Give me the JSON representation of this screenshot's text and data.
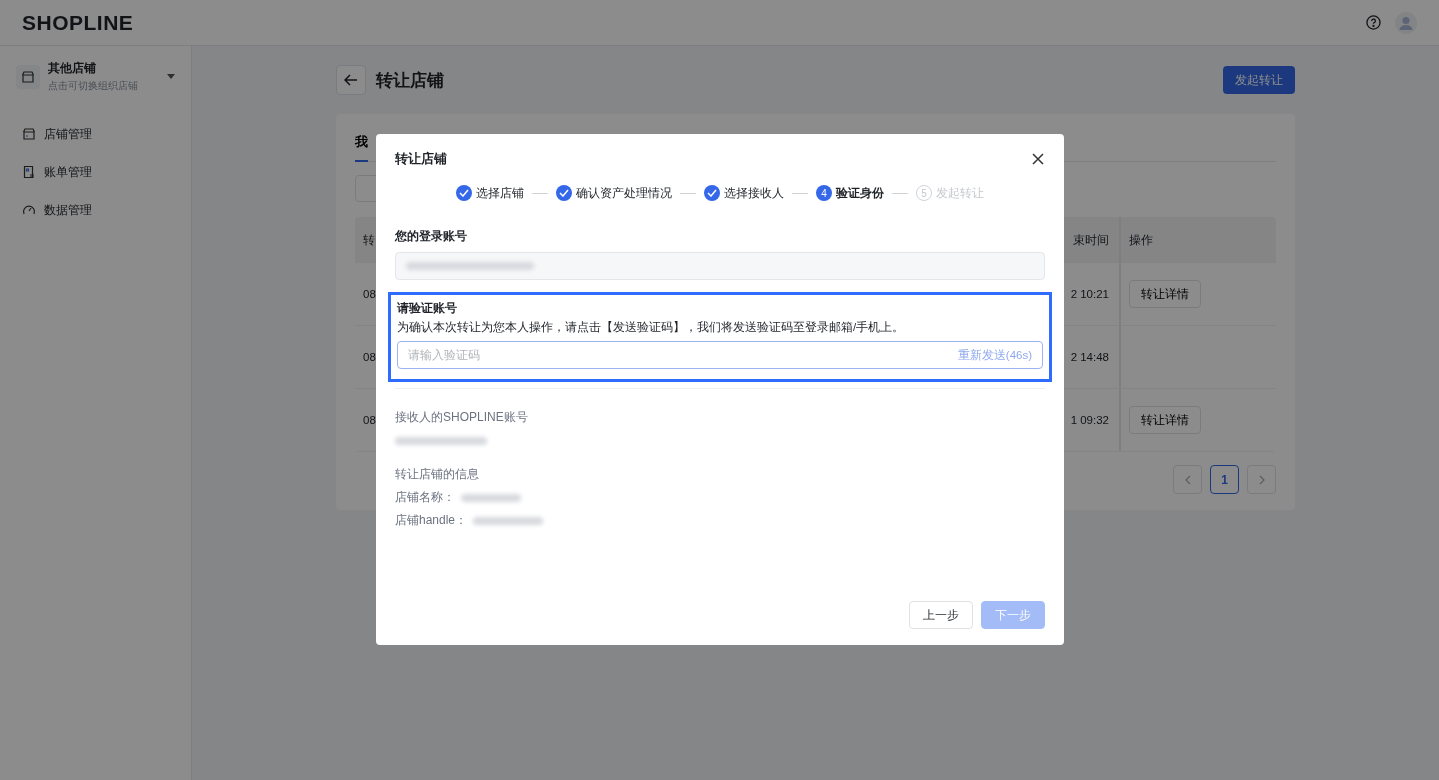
{
  "topbar": {
    "logo": "SHOPLINE"
  },
  "sidebar": {
    "store": {
      "name": "其他店铺",
      "hint": "点击可切换组织店铺"
    },
    "items": [
      {
        "label": "店铺管理",
        "selected": false
      },
      {
        "label": "账单管理",
        "selected": false
      },
      {
        "label": "数据管理",
        "selected": false
      }
    ]
  },
  "page": {
    "title": "转让店铺",
    "primary_button": "发起转让",
    "tabs": [
      {
        "label": "我",
        "selected": true
      }
    ],
    "table": {
      "columns": [
        "转",
        "束时间",
        "操作"
      ],
      "rows": [
        {
          "column_1": "08",
          "time": "2 10:21",
          "action": "转让详情"
        },
        {
          "column_1": "08",
          "time": "2 14:48"
        },
        {
          "column_1": "08",
          "time": "1 09:32",
          "action": "转让详情"
        }
      ]
    },
    "pagination": {
      "pages": [
        {
          "label": "1",
          "selected": true
        }
      ]
    }
  },
  "modal": {
    "title": "转让店铺",
    "steps": [
      {
        "label": "选择店铺",
        "done": true,
        "active": false
      },
      {
        "label": "确认资产处理情况",
        "done": true,
        "active": false
      },
      {
        "label": "选择接收人",
        "done": true,
        "active": false
      },
      {
        "label": "验证身份",
        "done": false,
        "active": true,
        "number": "4"
      },
      {
        "label": "发起转让",
        "done": false,
        "active": false,
        "number": "5"
      }
    ],
    "login_account": {
      "label": "您的登录账号",
      "disabled": true
    },
    "verify": {
      "title": "请验证账号",
      "description": "为确认本次转让为您本人操作，请点击【发送验证码】，我们将发送验证码至登录邮箱/手机上。",
      "placeholder": "请输入验证码",
      "resend": "重新发送(46s)",
      "highlighted": true
    },
    "receiver": {
      "label": "接收人的SHOPLINE账号"
    },
    "store_info": {
      "title": "转让店铺的信息",
      "fields": [
        {
          "label": "店铺名称："
        },
        {
          "label": "店铺handle："
        }
      ]
    },
    "buttons": [
      {
        "label": "上一步",
        "kind": "default",
        "disabled": false
      },
      {
        "label": "下一步",
        "kind": "primary",
        "disabled": true
      }
    ]
  }
}
